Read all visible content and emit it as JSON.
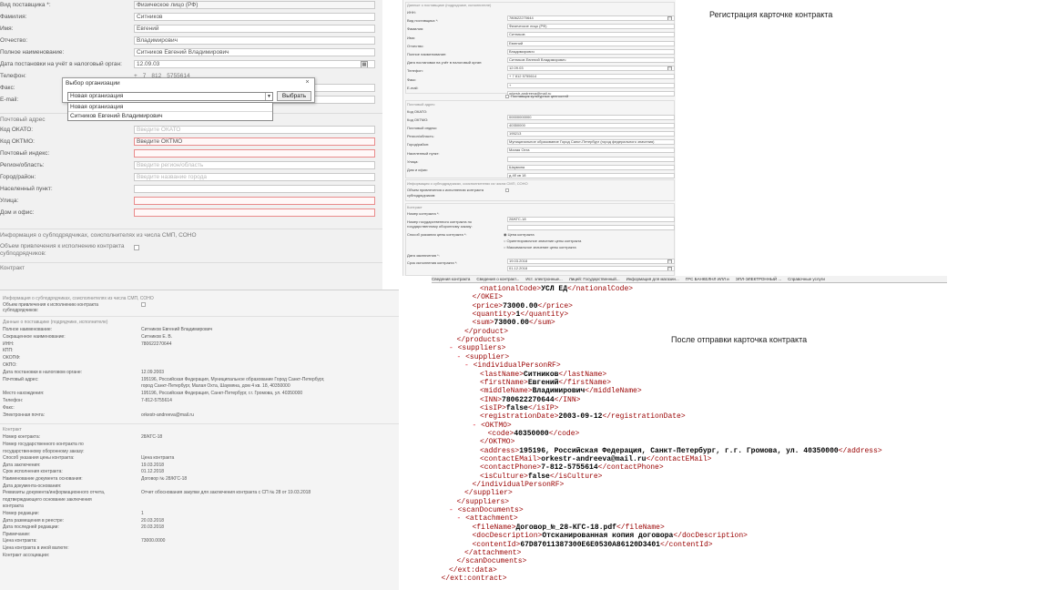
{
  "captions": {
    "top": "Регистрация карточке контракта",
    "bottom": "После отправки карточка контракта"
  },
  "form_a": {
    "rows": [
      {
        "label": "Вид поставщика *:",
        "value": "Физическое лицо (РФ)",
        "state": "ro"
      },
      {
        "label": "Фамилия:",
        "value": "Ситников",
        "state": ""
      },
      {
        "label": "Имя:",
        "value": "Евгений",
        "state": ""
      },
      {
        "label": "Отчество:",
        "value": "Владимирович",
        "state": ""
      },
      {
        "label": "Полное наименование:",
        "value": "Ситников Евгений Владимирович",
        "state": ""
      },
      {
        "label": "Дата постановки на учёт в налоговый орган:",
        "value": "12.09.03",
        "state": "cal"
      },
      {
        "label": "Телефон:",
        "value": "",
        "state": "phone"
      },
      {
        "label": "Факс:",
        "value": "",
        "state": ""
      },
      {
        "label": "E-mail:",
        "value": "",
        "state": ""
      }
    ],
    "phone_parts": [
      "+",
      "7",
      "812",
      "5755614"
    ],
    "address_head": "Почтовый адрес",
    "address_rows": [
      {
        "label": "Код ОКАТО:",
        "value": "Введите ОКАТО",
        "state": "ph"
      },
      {
        "label": "Код ОКТМО:",
        "value": "Введите ОКТМО",
        "state": "err"
      },
      {
        "label": "Почтовый индекс:",
        "value": "",
        "state": "err"
      },
      {
        "label": "Регион/область:",
        "value": "Введите регион/область",
        "state": "ph"
      },
      {
        "label": "Город/район:",
        "value": "Введите название города",
        "state": "ph"
      },
      {
        "label": "Населенный пункт:",
        "value": "",
        "state": ""
      },
      {
        "label": "Улица:",
        "value": "",
        "state": "err"
      },
      {
        "label": "Дом и офис:",
        "value": "",
        "state": "err"
      }
    ],
    "smp_head": "Информация о субподрядчиках, соисполнителях из числа СМП, СОНО",
    "smp_label_1": "Объем привлечения к исполнению контракта",
    "smp_label_2": "субподрядчиков:",
    "contract_head": "Контракт"
  },
  "dialog": {
    "title": "Выбор организации",
    "close": "×",
    "selected": "Новая организация",
    "button": "Выбрать",
    "options": [
      "Новая организация",
      "Ситников Евгений Владимирович"
    ]
  },
  "form_b": {
    "top_head": "Информация о субподрядчиках, соисполнителях из числа СМП, СОНО",
    "top_label_1": "Объем привлечения к исполнению контракта",
    "top_label_2": "субподрядчиков:",
    "supplier_head": "Данные о поставщике (подрядчике, исполнителе)",
    "supplier_rows": [
      [
        "Полное наименование:",
        "Ситников Евгений Владимирович"
      ],
      [
        "Сокращенное наименование:",
        "Ситников Е. В."
      ],
      [
        "ИНН:",
        "780622270644"
      ],
      [
        "КПП:",
        ""
      ],
      [
        "ОКОПФ:",
        ""
      ],
      [
        "ОКПО:",
        ""
      ],
      [
        "Дата постановки в налоговом органе:",
        "12.09.2003"
      ],
      [
        "Почтовый адрес:",
        "195196, Российская Федерация, Муниципальное образование Город Санкт-Петербург,"
      ],
      [
        "",
        "город Санкт-Петербург, Малая Охта, Шаумяна, дом 4 кв. 18, 40350000"
      ],
      [
        "Место нахождения:",
        "195196, Российская Федерация, Санкт-Петербург, г.г. Громова, ул. 40350000"
      ],
      [
        "Телефон:",
        "7-812-5755614"
      ],
      [
        "Факс:",
        ""
      ],
      [
        "Электронная почта:",
        "orkestr-andreeva@mail.ru"
      ]
    ],
    "contract_head": "Контракт",
    "contract_rows": [
      [
        "Номер контракта:",
        "28/КГС-18"
      ],
      [
        "Номер государственного контракта по",
        ""
      ],
      [
        "государственному оборонному заказу:",
        ""
      ],
      [
        "Способ указания цены контракта:",
        "Цена контракта"
      ],
      [
        "Дата заключения:",
        "19.03.2018"
      ],
      [
        "Срок исполнения контракта:",
        "01.12.2018"
      ],
      [
        "Наименование документа основания:",
        "Договор № 28/КГС-18"
      ],
      [
        "Дата документа-основания:",
        ""
      ],
      [
        "Реквизиты документа/информационного отчета,",
        "Отчет обоснования закупки для заключения контракта с СП № 28 от 19.03.2018"
      ],
      [
        "подтверждающего основание заключения",
        ""
      ],
      [
        "контракта",
        ""
      ],
      [
        "Номер редакции:",
        "1"
      ],
      [
        "Дата размещения в реестре:",
        "20.03.2018"
      ],
      [
        "Дата последней редакции:",
        "20.03.2018"
      ],
      [
        "Примечание:",
        ""
      ],
      [
        "Цена контракта:",
        "73000.0000"
      ],
      [
        "Цена контракта в иной валюте:",
        ""
      ],
      [
        "Контракт ассоциации:",
        ""
      ]
    ]
  },
  "form_c": {
    "head": "Данные о поставщике (подрядчике, исполнителе)",
    "rows": [
      [
        "ИНН:",
        "780622270644"
      ],
      [
        "Вид поставщика *:",
        "Физическое лицо (РФ)"
      ],
      [
        "Фамилия:",
        "Ситников"
      ],
      [
        "Имя:",
        "Евгений"
      ],
      [
        "Отчество:",
        "Владимирович"
      ],
      [
        "Полное наименование:",
        "Ситников Евгений Владимирович"
      ],
      [
        "Дата постановки на учёт в налоговый орган:",
        "12.09.03"
      ],
      [
        "Телефон:",
        "+  7  812  5755614"
      ],
      [
        "Факс:",
        "+"
      ],
      [
        "E-mail:",
        "orkestr-andreeva@mail.ru"
      ]
    ],
    "culture_label": "Поставщик культурных ценностей",
    "addr_head": "Почтовый адрес",
    "addr_rows": [
      [
        "Код ОКАТО:",
        "00000000000"
      ],
      [
        "Код ОКТМО:",
        "40350000"
      ],
      [
        "Почтовый индекс:",
        "195213"
      ],
      [
        "Регион/область:",
        "Муниципальное образование Город Санкт-Петербург (город федерального значения)"
      ],
      [
        "Город/район:",
        "Малая Охта"
      ],
      [
        "Населенный пункт:",
        ""
      ],
      [
        "Улица:",
        "Шаумяна"
      ],
      [
        "Дом и офис:",
        "д.4б кв 18"
      ]
    ],
    "smp_head": "Информация о субподрядчиках, соисполнителях из числа СМП, СОНО",
    "smp_label": "Объем привлечения к исполнению контракта субподрядчиков:",
    "contract_head": "Контракт",
    "contract_rows": [
      [
        "Номер контракта *:",
        "28/КГС-18"
      ],
      [
        "Номер государственного контракта по",
        ""
      ],
      [
        "государственному оборонному заказу:",
        ""
      ]
    ],
    "price_label": "Способ указания цены контракта *:",
    "price_options": [
      "Цена контракта",
      "Ориентировочное значение цены контракта",
      "Максимальное значение цены контракта"
    ],
    "date_rows": [
      [
        "Дата заключения *:",
        "19.03.2018"
      ],
      [
        "Срок исполнения контракта *:",
        "01.12.2018"
      ]
    ]
  },
  "browser_tabs": [
    "Сведения контракта",
    "Сведения о контракт...",
    "Ист. электронные...",
    "Лицей: Государственный...",
    "Информация для магазин...",
    "ГРС БАНКЕЛНЛ ИЛЛ и",
    "ЭПЛ-ЭЛЕКТРОННЫЙ ...",
    "Справочные услуги"
  ],
  "xml_lines": [
    {
      "i": 6,
      "parts": [
        [
          "t",
          "<nationalCode>"
        ],
        [
          "b",
          "УСЛ ЕД"
        ],
        [
          "t",
          "</nationalCode>"
        ]
      ]
    },
    {
      "i": 5,
      "parts": [
        [
          "t",
          "</OKEI>"
        ]
      ]
    },
    {
      "i": 5,
      "parts": [
        [
          "t",
          "<price>"
        ],
        [
          "b",
          "73000.00"
        ],
        [
          "t",
          "</price>"
        ]
      ]
    },
    {
      "i": 5,
      "parts": [
        [
          "t",
          "<quantity>"
        ],
        [
          "b",
          "1"
        ],
        [
          "t",
          "</quantity>"
        ]
      ]
    },
    {
      "i": 5,
      "parts": [
        [
          "t",
          "<sum>"
        ],
        [
          "b",
          "73000.00"
        ],
        [
          "t",
          "</sum>"
        ]
      ]
    },
    {
      "i": 4,
      "parts": [
        [
          "t",
          "</product>"
        ]
      ]
    },
    {
      "i": 3,
      "parts": [
        [
          "t",
          "</products>"
        ]
      ]
    },
    {
      "i": 2,
      "parts": [
        [
          "m",
          "- "
        ],
        [
          "t",
          "<suppliers>"
        ]
      ]
    },
    {
      "i": 3,
      "parts": [
        [
          "m",
          "- "
        ],
        [
          "t",
          "<supplier>"
        ]
      ]
    },
    {
      "i": 4,
      "parts": [
        [
          "m",
          "- "
        ],
        [
          "t",
          "<individualPersonRF>"
        ]
      ]
    },
    {
      "i": 6,
      "parts": [
        [
          "t",
          "<lastName>"
        ],
        [
          "b",
          "Ситников"
        ],
        [
          "t",
          "</lastName>"
        ]
      ]
    },
    {
      "i": 6,
      "parts": [
        [
          "t",
          "<firstName>"
        ],
        [
          "b",
          "Евгений"
        ],
        [
          "t",
          "</firstName>"
        ]
      ]
    },
    {
      "i": 6,
      "parts": [
        [
          "t",
          "<middleName>"
        ],
        [
          "b",
          "Владимирович"
        ],
        [
          "t",
          "</middleName>"
        ]
      ]
    },
    {
      "i": 6,
      "parts": [
        [
          "t",
          "<INN>"
        ],
        [
          "b",
          "780622270644"
        ],
        [
          "t",
          "</INN>"
        ]
      ]
    },
    {
      "i": 6,
      "parts": [
        [
          "t",
          "<isIP>"
        ],
        [
          "b",
          "false"
        ],
        [
          "t",
          "</isIP>"
        ]
      ]
    },
    {
      "i": 6,
      "parts": [
        [
          "t",
          "<registrationDate>"
        ],
        [
          "b",
          "2003-09-12"
        ],
        [
          "t",
          "</registrationDate>"
        ]
      ]
    },
    {
      "i": 5,
      "parts": [
        [
          "m",
          "- "
        ],
        [
          "t",
          "<OKTMO>"
        ]
      ]
    },
    {
      "i": 7,
      "parts": [
        [
          "t",
          "<code>"
        ],
        [
          "b",
          "40350000"
        ],
        [
          "t",
          "</code>"
        ]
      ]
    },
    {
      "i": 6,
      "parts": [
        [
          "t",
          "</OKTMO>"
        ]
      ]
    },
    {
      "i": 6,
      "parts": [
        [
          "t",
          "<address>"
        ],
        [
          "b",
          "195196, Российская Федерация, Санкт-Петербург, г.г. Громова, ул. 40350000"
        ],
        [
          "t",
          "</address>"
        ]
      ]
    },
    {
      "i": 6,
      "parts": [
        [
          "t",
          "<contactEMail>"
        ],
        [
          "b",
          "orkestr-andreeva@mail.ru"
        ],
        [
          "t",
          "</contactEMail>"
        ]
      ]
    },
    {
      "i": 6,
      "parts": [
        [
          "t",
          "<contactPhone>"
        ],
        [
          "b",
          "7-812-5755614"
        ],
        [
          "t",
          "</contactPhone>"
        ]
      ]
    },
    {
      "i": 6,
      "parts": [
        [
          "t",
          "<isCulture>"
        ],
        [
          "b",
          "false"
        ],
        [
          "t",
          "</isCulture>"
        ]
      ]
    },
    {
      "i": 5,
      "parts": [
        [
          "t",
          "</individualPersonRF>"
        ]
      ]
    },
    {
      "i": 4,
      "parts": [
        [
          "t",
          "</supplier>"
        ]
      ]
    },
    {
      "i": 3,
      "parts": [
        [
          "t",
          "</suppliers>"
        ]
      ]
    },
    {
      "i": 2,
      "parts": [
        [
          "m",
          "- "
        ],
        [
          "t",
          "<scanDocuments>"
        ]
      ]
    },
    {
      "i": 3,
      "parts": [
        [
          "m",
          "- "
        ],
        [
          "t",
          "<attachment>"
        ]
      ]
    },
    {
      "i": 5,
      "parts": [
        [
          "t",
          "<fileName>"
        ],
        [
          "b",
          "Договор_№_28-КГС-18.pdf"
        ],
        [
          "t",
          "</fileName>"
        ]
      ]
    },
    {
      "i": 5,
      "parts": [
        [
          "t",
          "<docDescription>"
        ],
        [
          "b",
          "Отсканированная копия договора"
        ],
        [
          "t",
          "</docDescription>"
        ]
      ]
    },
    {
      "i": 5,
      "parts": [
        [
          "t",
          "<contentId>"
        ],
        [
          "b",
          "67D87011387300E6E0530A86120D3401"
        ],
        [
          "t",
          "</contentId>"
        ]
      ]
    },
    {
      "i": 4,
      "parts": [
        [
          "t",
          "</attachment>"
        ]
      ]
    },
    {
      "i": 3,
      "parts": [
        [
          "t",
          "</scanDocuments>"
        ]
      ]
    },
    {
      "i": 2,
      "parts": [
        [
          "t",
          "</ext:data>"
        ]
      ]
    },
    {
      "i": 1,
      "parts": [
        [
          "t",
          "</ext:contract>"
        ]
      ]
    }
  ]
}
